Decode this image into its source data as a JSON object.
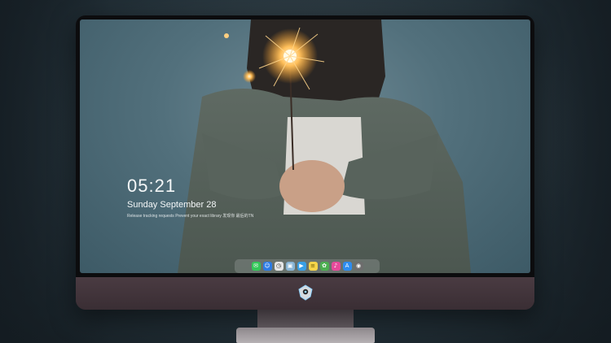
{
  "lock_screen": {
    "time": "05:21",
    "date": "Sunday September  28",
    "hint": "Release tracking requests Prevent your exact library 发现你 最后的TN"
  },
  "dock": {
    "items": [
      {
        "name": "messages-icon",
        "color": "#34c759"
      },
      {
        "name": "finder-icon",
        "color": "#2c7be5"
      },
      {
        "name": "clock-icon",
        "color": "#e6e6e6"
      },
      {
        "name": "preview-icon",
        "color": "#8ab6d6"
      },
      {
        "name": "clapper-icon",
        "color": "#39a0e6"
      },
      {
        "name": "notes-icon",
        "color": "#f6d44a"
      },
      {
        "name": "photos-icon",
        "color": "#4caf50"
      },
      {
        "name": "music-icon",
        "color": "#e64a9a"
      },
      {
        "name": "app-store-icon",
        "color": "#2d8cf0"
      },
      {
        "name": "camera-icon",
        "color": "#6d6d6d"
      }
    ]
  }
}
